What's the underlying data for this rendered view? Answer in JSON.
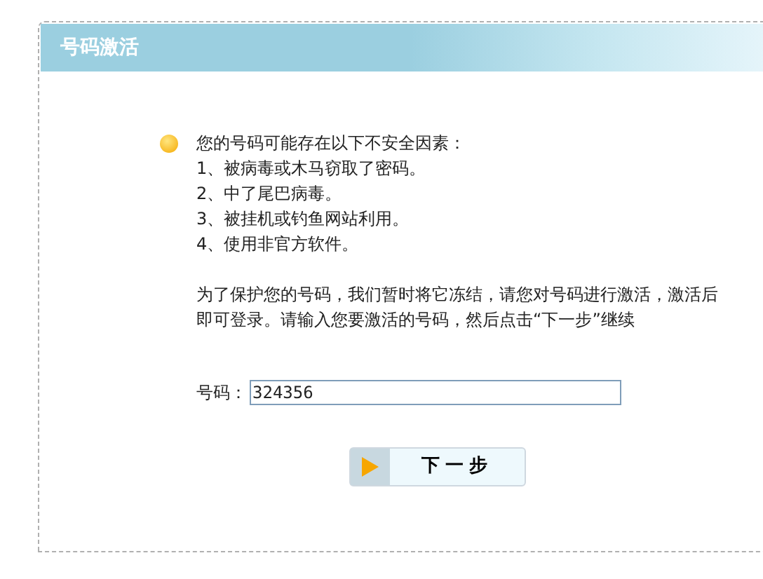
{
  "header": {
    "title": "号码激活"
  },
  "notice": {
    "heading": "您的号码可能存在以下不安全因素：",
    "items": [
      "1、被病毒或木马窃取了密码。",
      "2、中了尾巴病毒。",
      "3、被挂机或钓鱼网站利用。",
      "4、使用非官方软件。"
    ],
    "paragraph": "为了保护您的号码，我们暂时将它冻结，请您对号码进行激活，激活后即可登录。请输入您要激活的号码，然后点击“下一步”继续"
  },
  "form": {
    "label": "号码：",
    "value": "324356"
  },
  "next_button": {
    "label": "下一步"
  }
}
